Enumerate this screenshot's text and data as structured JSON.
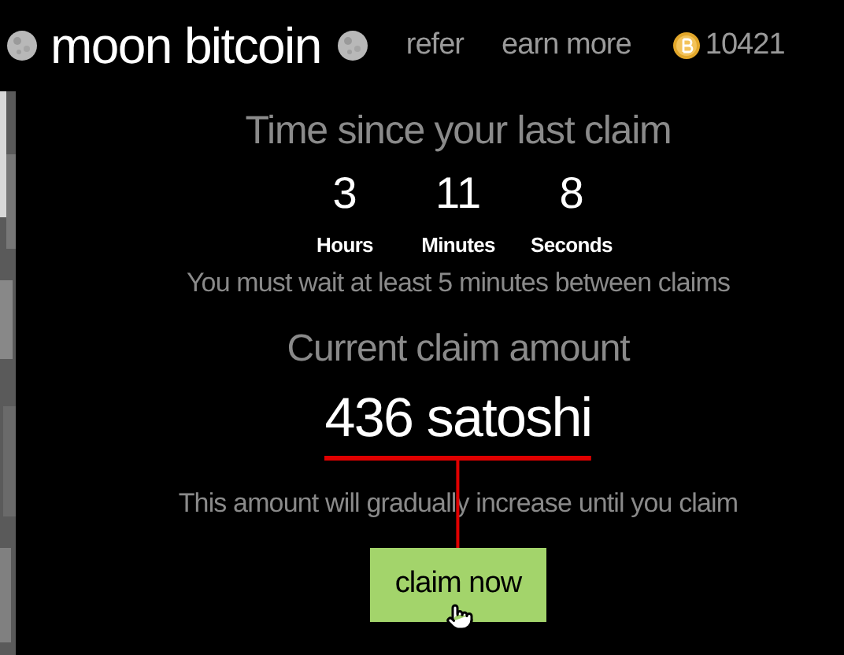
{
  "header": {
    "title": "moon bitcoin",
    "nav": [
      {
        "label": "refer"
      },
      {
        "label": "earn more"
      }
    ],
    "balance": "10421"
  },
  "timer": {
    "title": "Time since your last claim",
    "units": [
      {
        "value": "3",
        "label": "Hours"
      },
      {
        "value": "11",
        "label": "Minutes"
      },
      {
        "value": "8",
        "label": "Seconds"
      }
    ],
    "note": "You must wait at least 5 minutes between claims"
  },
  "claim": {
    "title": "Current claim amount",
    "amount": "436 satoshi",
    "note": "This amount will gradually increase until you claim",
    "button": "claim now"
  }
}
